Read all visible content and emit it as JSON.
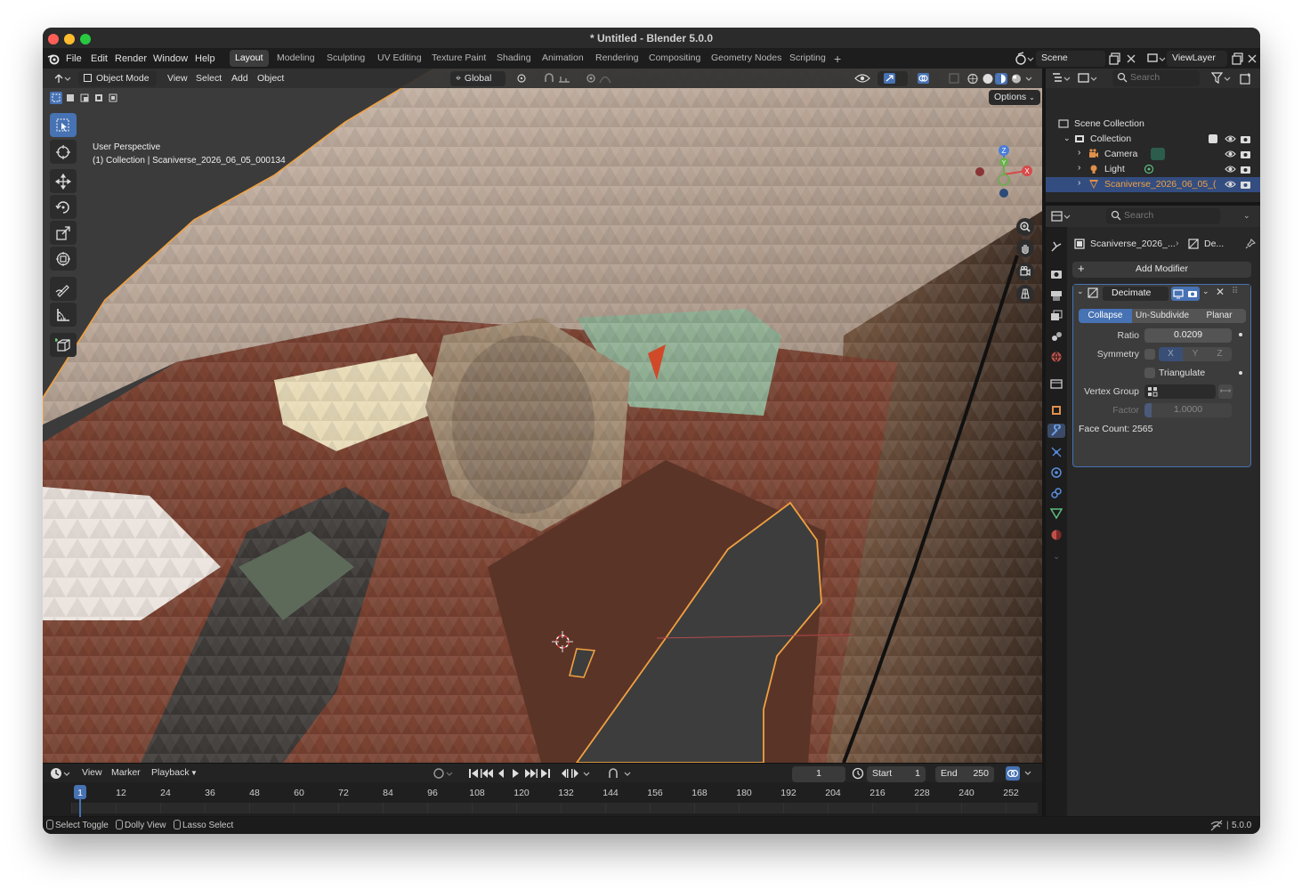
{
  "window": {
    "title": "* Untitled - Blender 5.0.0"
  },
  "menubar": {
    "menus": [
      "File",
      "Edit",
      "Render",
      "Window",
      "Help"
    ],
    "workspaces": [
      "Layout",
      "Modeling",
      "Sculpting",
      "UV Editing",
      "Texture Paint",
      "Shading",
      "Animation",
      "Rendering",
      "Compositing",
      "Geometry Nodes",
      "Scripting"
    ],
    "active_workspace": "Layout",
    "scene": "Scene",
    "view_layer": "ViewLayer"
  },
  "viewport": {
    "mode": "Object Mode",
    "menus": [
      "View",
      "Select",
      "Add",
      "Object"
    ],
    "orientation": "Global",
    "options_label": "Options",
    "overlay_line1": "User Perspective",
    "overlay_line2": "(1) Collection | Scaniverse_2026_06_05_000134",
    "gizmo_axes": {
      "x": "X",
      "y": "Y",
      "z": "Z"
    }
  },
  "outliner": {
    "search_placeholder": "Search",
    "root": "Scene Collection",
    "collection": "Collection",
    "items": [
      "Camera",
      "Light",
      "Scaniverse_2026_06_05_("
    ]
  },
  "properties": {
    "search_placeholder": "Search",
    "breadcrumb_object": "Scaniverse_2026_...",
    "breadcrumb_modifier": "De...",
    "add_modifier": "Add Modifier",
    "modifier": {
      "name": "Decimate",
      "modes": [
        "Collapse",
        "Un-Subdivide",
        "Planar"
      ],
      "active_mode": "Collapse",
      "ratio_label": "Ratio",
      "ratio": "0.0209",
      "symmetry_label": "Symmetry",
      "symmetry_axes": [
        "X",
        "Y",
        "Z"
      ],
      "triangulate_label": "Triangulate",
      "vertex_group_label": "Vertex Group",
      "factor_label": "Factor",
      "factor": "1.0000",
      "face_count": "Face Count: 2565"
    }
  },
  "timeline": {
    "menus": [
      "View",
      "Marker",
      "Playback"
    ],
    "current_frame": "1",
    "start_label": "Start",
    "start": "1",
    "end_label": "End",
    "end": "250",
    "ticks": [
      "1",
      "12",
      "24",
      "36",
      "48",
      "60",
      "72",
      "84",
      "96",
      "108",
      "120",
      "132",
      "144",
      "156",
      "168",
      "180",
      "192",
      "204",
      "216",
      "228",
      "240",
      "252"
    ]
  },
  "statusbar": {
    "hints": [
      "Select Toggle",
      "Dolly View",
      "Lasso Select"
    ],
    "version": "5.0.0"
  },
  "colors": {
    "accent": "#4772b3",
    "selection_outline": "#f0a040",
    "background": "#161616"
  }
}
